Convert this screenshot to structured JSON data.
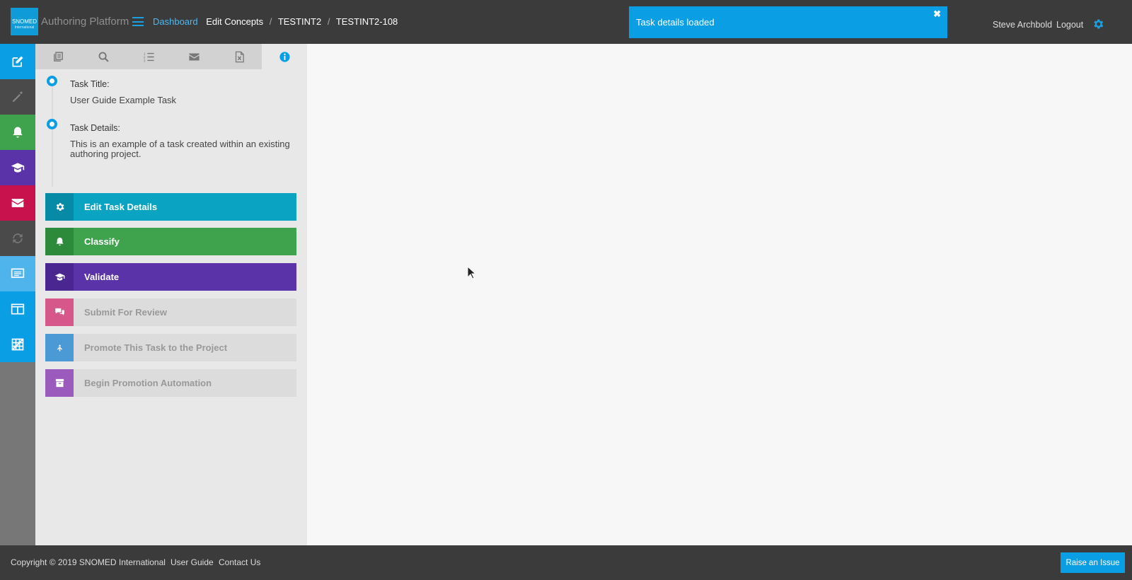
{
  "header": {
    "logo_text": "SNOMED",
    "logo_subtext": "International",
    "app_title": "Authoring Platform",
    "breadcrumb": {
      "dashboard": "Dashboard",
      "edit_concepts": "Edit Concepts",
      "project": "TESTINT2",
      "task": "TESTINT2-108",
      "separator": "/"
    },
    "toast_message": "Task details loaded",
    "toast_close": "✖",
    "user_name": "Steve Archbold",
    "logout": "Logout"
  },
  "rail": {
    "items": [
      {
        "icon": "edit-icon",
        "color": "#0a9ee5"
      },
      {
        "icon": "magic-wand-icon",
        "color": "#4a4a4a"
      },
      {
        "icon": "bell-icon",
        "color": "#3fa34d"
      },
      {
        "icon": "graduation-cap-icon",
        "color": "#5b33a8"
      },
      {
        "icon": "envelope-icon",
        "color": "#c8124e"
      },
      {
        "icon": "sync-icon",
        "color": "#4a4a4a"
      },
      {
        "icon": "monitor-list-icon",
        "color": "#4fb3ec"
      },
      {
        "icon": "window-icon",
        "color": "#0a9ee5"
      },
      {
        "icon": "grid-slash-icon",
        "color": "#0a9ee5"
      }
    ]
  },
  "panel": {
    "tabs": [
      {
        "icon": "books-icon"
      },
      {
        "icon": "search-icon"
      },
      {
        "icon": "ordered-list-icon"
      },
      {
        "icon": "envelope-icon"
      },
      {
        "icon": "excel-file-icon"
      },
      {
        "icon": "info-icon",
        "active": true
      }
    ],
    "task_title_label": "Task Title:",
    "task_title_value": "User Guide Example Task",
    "task_details_label": "Task Details:",
    "task_details_value": "This is an example of a task created within an existing authoring project.",
    "actions": [
      {
        "label": "Edit Task Details",
        "icon": "gear-icon",
        "color": "#0aa3c2",
        "icon_bg": "#078aa6",
        "enabled": true
      },
      {
        "label": "Classify",
        "icon": "bell-icon",
        "color": "#3fa34d",
        "icon_bg": "#2e8a3b",
        "enabled": true
      },
      {
        "label": "Validate",
        "icon": "graduation-cap-icon",
        "color": "#5b33a8",
        "icon_bg": "#4a2690",
        "enabled": true
      },
      {
        "label": "Submit For Review",
        "icon": "comments-icon",
        "color": "#dcdcdc",
        "icon_bg": "#d6578a",
        "enabled": false
      },
      {
        "label": "Promote This Task to the Project",
        "icon": "merge-arrow-icon",
        "color": "#dcdcdc",
        "icon_bg": "#4b9ad6",
        "enabled": false
      },
      {
        "label": "Begin Promotion Automation",
        "icon": "archive-icon",
        "color": "#dcdcdc",
        "icon_bg": "#9b5bbd",
        "enabled": false
      }
    ]
  },
  "footer": {
    "copyright": "Copyright © 2019 SNOMED International",
    "user_guide": "User Guide",
    "contact_us": "Contact Us",
    "raise_issue": "Raise an Issue"
  }
}
